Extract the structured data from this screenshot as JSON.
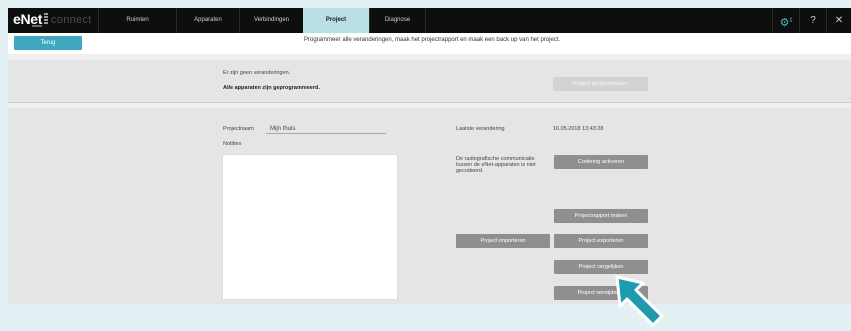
{
  "nav": {
    "logo_main": "eNet",
    "logo_sub": "connect",
    "tabs": [
      {
        "label": "Ruimten",
        "active": false
      },
      {
        "label": "Apparaten",
        "active": false
      },
      {
        "label": "Verbindingen",
        "active": false
      },
      {
        "label": "Project",
        "active": true
      },
      {
        "label": "Diagnose",
        "active": false
      }
    ],
    "settings_badge": "1",
    "help_label": "?",
    "close_label": "✕"
  },
  "subbar": {
    "back_label": "Terug",
    "info_text": "Programmeer alle veranderingen, maak het projectrapport en maak een back up van het project."
  },
  "status": {
    "line1": "Er zijn geen veranderingen.",
    "line2": "Alle apparaten zijn geprogrammeerd.",
    "program_button": "Project programmeren"
  },
  "project": {
    "name_label": "Projectnaam",
    "name_value": "Mijn thuis",
    "notes_label": "Notities",
    "notes_placeholder": "....",
    "last_change_label": "Laatste verandering",
    "last_change_value": "16.05.2018 13:43:28",
    "radio_note": "De radiografische communicatie tussen de eNet-apparaten is niet gecodeerd.",
    "buttons": {
      "encrypt": "Codering activeren",
      "report": "Projectrapport maken",
      "import": "Project importeren",
      "export": "Project exporteren",
      "compare": "Project vergelijken",
      "delete": "Project verwijderen"
    }
  },
  "colors": {
    "accent": "#3fa8c0",
    "active_tab": "#b9dfe7",
    "arrow": "#1f9bb0"
  }
}
